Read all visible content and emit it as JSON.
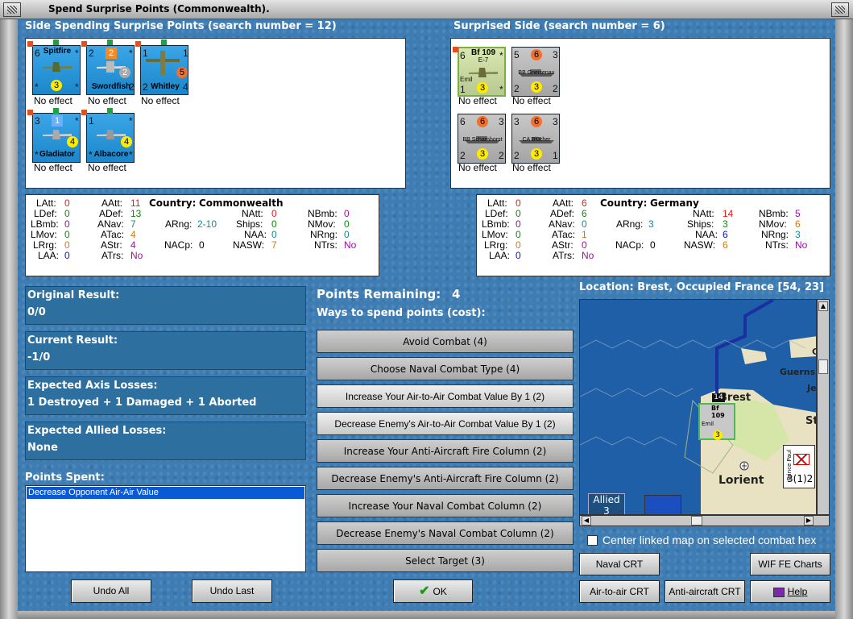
{
  "window": {
    "title": "Spend Surprise Points (Commonwealth)."
  },
  "left": {
    "header": "Side Spending Surprise Points (search number = 12)",
    "units": [
      {
        "name": "Spitfire",
        "a": "6",
        "b": "3",
        "c": "*",
        "d": "*",
        "e": "*",
        "effect": "No effect"
      },
      {
        "name": "Swordfish",
        "a": "2",
        "b": "2",
        "c": "2",
        "d": "*",
        "e": "2",
        "effect": "No effect"
      },
      {
        "name": "Whitley",
        "a": "1",
        "b": "5",
        "c": "1",
        "d": "2",
        "e": "4",
        "effect": "No effect"
      },
      {
        "name": "Gladiator",
        "a": "3",
        "b": "1",
        "c": "4",
        "d": "*",
        "e": "*",
        "effect": "No effect"
      },
      {
        "name": "Albacore",
        "a": "1",
        "b": "4",
        "c": "*",
        "d": "*",
        "e": "*",
        "effect": "No effect"
      }
    ]
  },
  "right": {
    "header": "Surprised Side (search number = 6)",
    "units": [
      {
        "name": "Bf 109",
        "sub": "E-7",
        "pilot": "Emil",
        "a": "6",
        "b": "3",
        "c": "1",
        "d": "*",
        "e": "*",
        "effect": "No effect"
      },
      {
        "name": "BB Gneisenau",
        "a": "5",
        "b": "6",
        "c": "3",
        "d": "2",
        "e": "3",
        "f": "2",
        "effect": "No effect"
      },
      {
        "name": "BB Scharnhorst",
        "a": "6",
        "b": "6",
        "c": "3",
        "d": "2",
        "e": "3",
        "f": "2",
        "effect": "No effect"
      },
      {
        "name": "CA Blücher",
        "a": "3",
        "b": "6",
        "c": "3",
        "d": "2",
        "e": "3",
        "f": "1",
        "effect": "No effect"
      }
    ]
  },
  "stats_left": {
    "country_label": "Country:",
    "country": "Commonwealth",
    "LAtt": "0",
    "LDef": "0",
    "LBmb": "0",
    "LMov": "0",
    "LRrg": "0",
    "LAA": "0",
    "AAtt": "11",
    "ADef": "13",
    "ANav": "7",
    "ATac": "4",
    "AStr": "4",
    "ATrs": "No",
    "ARng": "2-10",
    "NACp": "0",
    "NAtt": "0",
    "Ships": "0",
    "NAA": "0",
    "NASW": "7",
    "NBmb": "0",
    "NMov": "0",
    "NRng": "0",
    "NTrs": "No"
  },
  "stats_right": {
    "country_label": "Country:",
    "country": "Germany",
    "LAtt": "0",
    "LDef": "0",
    "LBmb": "0",
    "LMov": "0",
    "LRrg": "0",
    "LAA": "0",
    "AAtt": "6",
    "ADef": "6",
    "ANav": "0",
    "ATac": "1",
    "AStr": "0",
    "ATrs": "No",
    "ARng": "3",
    "NACp": "0",
    "NAtt": "14",
    "Ships": "3",
    "NAA": "6",
    "NASW": "6",
    "NBmb": "5",
    "NMov": "6",
    "NRng": "3",
    "NTrs": "No"
  },
  "labels": {
    "LAtt": "LAtt:",
    "LDef": "LDef:",
    "LBmb": "LBmb:",
    "LMov": "LMov:",
    "LRrg": "LRrg:",
    "LAA": "LAA:",
    "AAtt": "AAtt:",
    "ADef": "ADef:",
    "ANav": "ANav:",
    "ATac": "ATac:",
    "AStr": "AStr:",
    "ATrs": "ATrs:",
    "ARng": "ARng:",
    "NACp": "NACp:",
    "NAtt": "NAtt:",
    "Ships": "Ships:",
    "NAA": "NAA:",
    "NASW": "NASW:",
    "NBmb": "NBmb:",
    "NMov": "NMov:",
    "NRng": "NRng:",
    "NTrs": "NTrs:"
  },
  "results": {
    "original": {
      "title": "Original Result:",
      "value": "0/0"
    },
    "current": {
      "title": "Current Result:",
      "value": "-1/0"
    },
    "axis": {
      "title": "Expected Axis Losses:",
      "value": "1 Destroyed + 1 Damaged + 1 Aborted"
    },
    "allied": {
      "title": "Expected Allied Losses:",
      "value": "None"
    }
  },
  "points_spent": {
    "title": "Points Spent:",
    "items": [
      "Decrease Opponent Air-Air Value"
    ]
  },
  "points": {
    "remaining_label": "Points Remaining:",
    "remaining": "4",
    "ways": "Ways to spend points (cost):"
  },
  "options": [
    "Avoid Combat (4)",
    "Choose Naval Combat Type (4)",
    "Increase Your Air-to-Air Combat Value By 1 (2)",
    "Decrease Enemy's Air-to-Air Combat Value By 1 (2)",
    "Increase Your Anti-Aircraft Fire Column (2)",
    "Decrease Enemy's Anti-Aircraft Fire Column (2)",
    "Increase Your Naval Combat Column (2)",
    "Decrease Enemy's Naval Combat Column (2)",
    "Select Target (3)"
  ],
  "location": "Location: Brest, Occupied France [54, 23]",
  "map": {
    "labels": [
      "Brest",
      "Lorient",
      "Guerns",
      "Je",
      "St",
      "C"
    ],
    "allied_label": "Allied",
    "allied_num": "3",
    "stack_count": "14",
    "unit_counter": "3(1)2",
    "unit_name": "Prince Paul",
    "small_unit": "Bf 109",
    "small_sub": "Emil"
  },
  "center_checkbox": "Center linked map on selected combat hex",
  "buttons": {
    "naval_crt": "Naval CRT",
    "wif_charts": "WIF FE Charts",
    "air_crt": "Air-to-air CRT",
    "aa_crt": "Anti-aircraft CRT",
    "help": "Help",
    "undo_all": "Undo All",
    "undo_last": "Undo Last",
    "ok": "OK"
  },
  "colors": {
    "red": "#e02020",
    "green": "#0a8a0a",
    "teal": "#178a8a",
    "purple": "#9a10a0",
    "orange": "#d07a10",
    "blue": "#1010c0"
  }
}
